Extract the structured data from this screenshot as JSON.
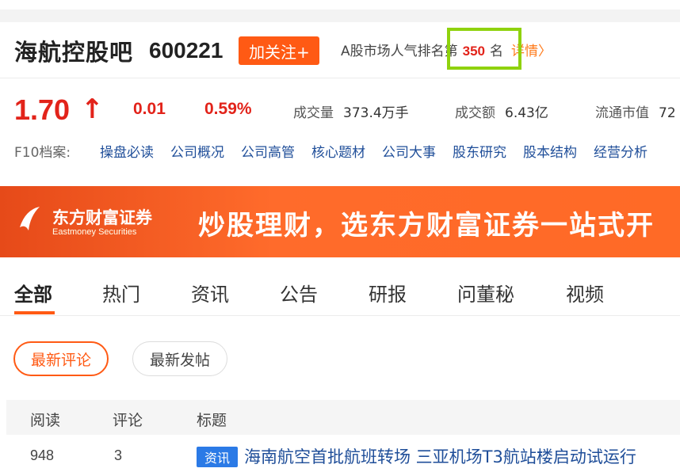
{
  "header": {
    "stock_name": "海航控股吧",
    "stock_code": "600221",
    "follow_label": "加关注+",
    "rank_prefix": "A股市场人气排名第",
    "rank_number": "350",
    "rank_suffix": "名",
    "detail_label": "详情〉"
  },
  "quote": {
    "price": "1.70",
    "arrow": "↑",
    "change": "0.01",
    "change_pct": "0.59%",
    "volume_label": "成交量",
    "volume_value": "373.4万手",
    "turnover_label": "成交额",
    "turnover_value": "6.43亿",
    "float_cap_label": "流通市值",
    "float_cap_value": "72"
  },
  "f10": {
    "label": "F10档案:",
    "links": [
      "操盘必读",
      "公司概况",
      "公司高管",
      "核心题材",
      "公司大事",
      "股东研究",
      "股本结构",
      "经营分析"
    ]
  },
  "banner": {
    "brand_cn": "东方财富证券",
    "brand_en": "Eastmoney Securities",
    "slogan": "炒股理财，选东方财富证券一站式开"
  },
  "tabs": [
    "全部",
    "热门",
    "资讯",
    "公告",
    "研报",
    "问董秘",
    "视频"
  ],
  "filters": {
    "active": "最新评论",
    "idle": "最新发帖"
  },
  "table": {
    "columns": [
      "阅读",
      "评论",
      "标题"
    ],
    "rows": [
      {
        "reads": "948",
        "comments": "3",
        "tag": "资讯",
        "title": "海南航空首批航班转场 三亚机场T3航站楼启动试运行"
      }
    ]
  },
  "colors": {
    "accent": "#ff5a14",
    "up_red": "#e2231a",
    "link_blue": "#1f4e99",
    "highlight_green": "#8fd20e"
  }
}
